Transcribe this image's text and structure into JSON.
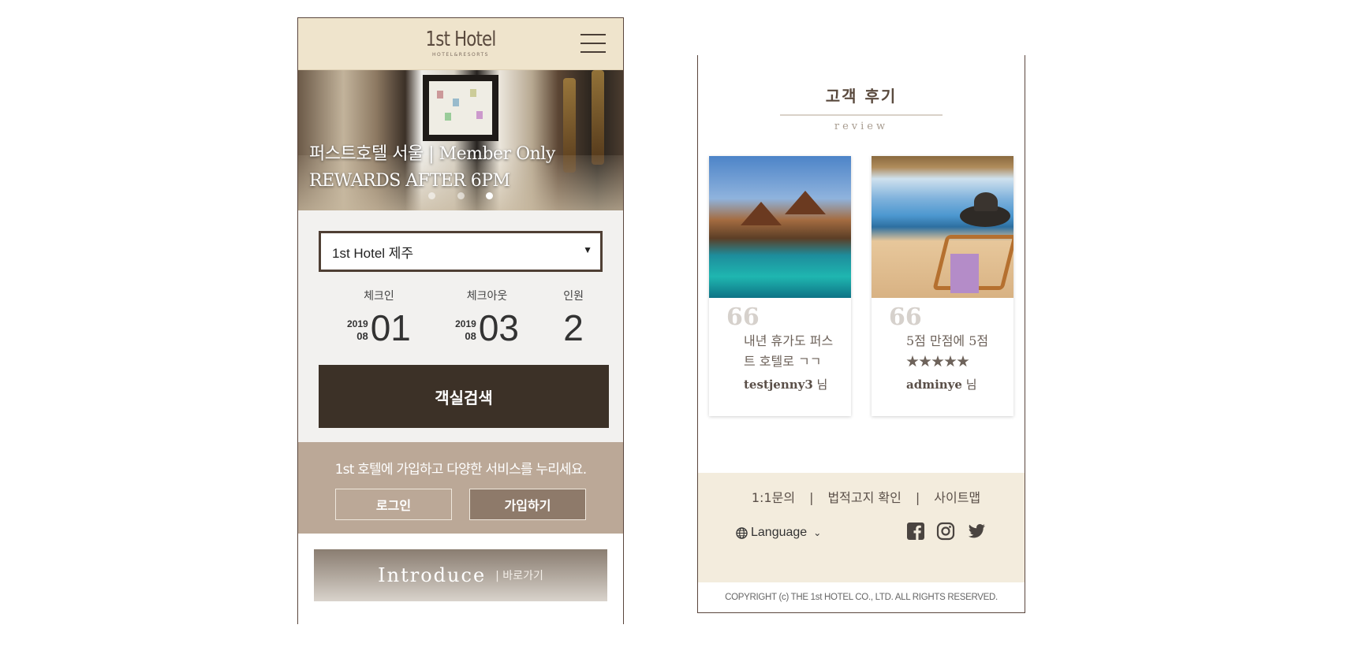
{
  "left_screen": {
    "header": {
      "logo_main": "1st Hotel",
      "logo_sub": "HOTEL&RESORTS"
    },
    "hero": {
      "line1": "퍼스트호텔 서울 | Member Only",
      "line2": "REWARDS AFTER 6PM",
      "slides": 3,
      "active_slide": 2
    },
    "booking": {
      "hotel_selected": "1st Hotel 제주",
      "checkin_label": "체크인",
      "checkout_label": "체크아웃",
      "guests_label": "인원",
      "checkin": {
        "year": "2019",
        "month": "08",
        "day": "01"
      },
      "checkout": {
        "year": "2019",
        "month": "08",
        "day": "03"
      },
      "guests": "2",
      "search_label": "객실검색"
    },
    "join": {
      "text": "1st 호텔에 가입하고 다양한 서비스를 누리세요.",
      "login_label": "로그인",
      "signup_label": "가입하기"
    },
    "intro": {
      "main": "Introduce",
      "sub": "| 바로가기"
    }
  },
  "right_screen": {
    "reviews": {
      "title": "고객 후기",
      "subtitle": "review",
      "quote_mark": "66",
      "items": [
        {
          "text": "내년 휴가도 퍼스트 호텔로 ㄱㄱ",
          "author": "testjenny3",
          "suffix": " 님"
        },
        {
          "text": "5점 만점에 5점 ★★★★★",
          "author": "adminye",
          "suffix": " 님"
        }
      ]
    },
    "footer": {
      "link_inquiry": "1:1문의",
      "link_legal": "법적고지 확인",
      "link_sitemap": "사이트맵",
      "separator": "|",
      "language_label": "Language",
      "copyright": "COPYRIGHT (c) THE 1st HOTEL CO., LTD. ALL RIGHTS RESERVED."
    }
  },
  "colors": {
    "header_bg": "#efe4cc",
    "search_button": "#3c3127",
    "join_band": "#bba897",
    "footer_bg": "#f3ecdd"
  }
}
